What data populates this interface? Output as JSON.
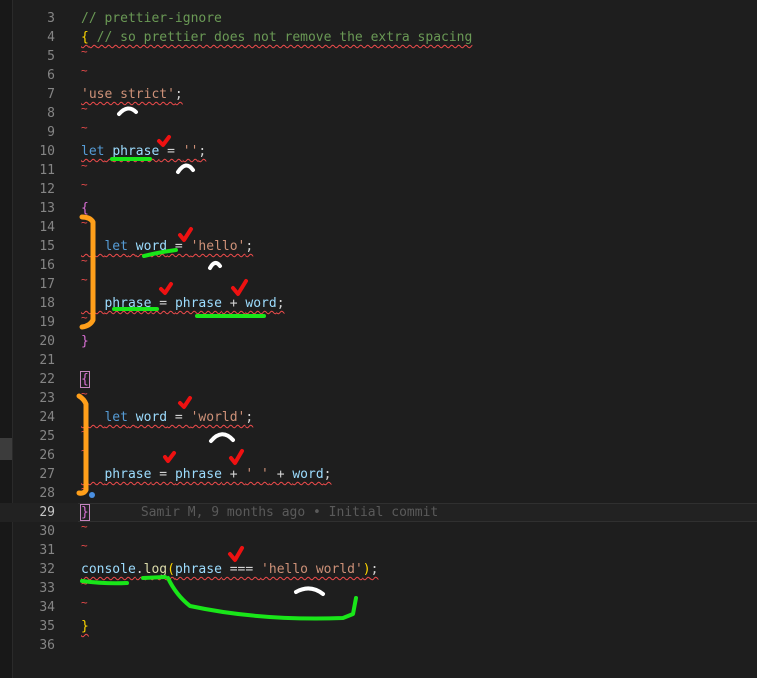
{
  "editor": {
    "lines": [
      {
        "n": "3",
        "parts": [
          [
            "c",
            "// prettier-ignore"
          ]
        ]
      },
      {
        "n": "4",
        "parts": [
          [
            "b1",
            "{"
          ],
          [
            "p",
            " "
          ],
          [
            "c",
            "// so prettier does not remove the extra spacing"
          ]
        ],
        "squig": true
      },
      {
        "n": "5",
        "tilde": true
      },
      {
        "n": "6",
        "tilde": true
      },
      {
        "n": "7",
        "parts": [
          [
            "s",
            "'use strict'"
          ],
          [
            "p",
            ";"
          ]
        ],
        "squig": true
      },
      {
        "n": "8",
        "tilde": true
      },
      {
        "n": "9",
        "tilde": true
      },
      {
        "n": "10",
        "parts": [
          [
            "k",
            "let"
          ],
          [
            "p",
            " "
          ],
          [
            "v",
            "phrase"
          ],
          [
            "p",
            " = "
          ],
          [
            "s",
            "''"
          ],
          [
            "p",
            ";"
          ]
        ],
        "squig": true
      },
      {
        "n": "11",
        "tilde": true
      },
      {
        "n": "12",
        "tilde": true
      },
      {
        "n": "13",
        "parts": [
          [
            "b2",
            "{"
          ]
        ]
      },
      {
        "n": "14",
        "tilde": true,
        "indent": true
      },
      {
        "n": "15",
        "parts": [
          [
            "p",
            "   "
          ],
          [
            "k",
            "let"
          ],
          [
            "p",
            " "
          ],
          [
            "v",
            "word"
          ],
          [
            "p",
            " = "
          ],
          [
            "s",
            "'hello'"
          ],
          [
            "p",
            ";"
          ]
        ],
        "squig": true
      },
      {
        "n": "16",
        "tilde": true,
        "indent": true
      },
      {
        "n": "17",
        "tilde": true,
        "indent": true
      },
      {
        "n": "18",
        "parts": [
          [
            "p",
            "   "
          ],
          [
            "v",
            "phrase"
          ],
          [
            "p",
            " = "
          ],
          [
            "v",
            "phrase"
          ],
          [
            "p",
            " + "
          ],
          [
            "v",
            "word"
          ],
          [
            "p",
            ";"
          ]
        ],
        "squig": true
      },
      {
        "n": "19",
        "tilde": true,
        "indent": true
      },
      {
        "n": "20",
        "parts": [
          [
            "b2",
            "}"
          ]
        ]
      },
      {
        "n": "21"
      },
      {
        "n": "22",
        "parts": [
          [
            "b2box",
            "{"
          ]
        ]
      },
      {
        "n": "23",
        "tilde": true,
        "indent": true
      },
      {
        "n": "24",
        "parts": [
          [
            "p",
            "   "
          ],
          [
            "k",
            "let"
          ],
          [
            "p",
            " "
          ],
          [
            "v",
            "word"
          ],
          [
            "p",
            " = "
          ],
          [
            "s",
            "'world'"
          ],
          [
            "p",
            ";"
          ]
        ],
        "squig": true
      },
      {
        "n": "25",
        "tilde": true,
        "indent": true
      },
      {
        "n": "26",
        "tilde": true,
        "indent": true
      },
      {
        "n": "27",
        "parts": [
          [
            "p",
            "   "
          ],
          [
            "v",
            "phrase"
          ],
          [
            "p",
            " = "
          ],
          [
            "v",
            "phrase"
          ],
          [
            "p",
            " + "
          ],
          [
            "s",
            "' '"
          ],
          [
            "p",
            " + "
          ],
          [
            "v",
            "word"
          ],
          [
            "p",
            ";"
          ]
        ],
        "squig": true
      },
      {
        "n": "28",
        "tilde": true,
        "indent": true
      },
      {
        "n": "29",
        "parts": [
          [
            "b2box",
            "}"
          ]
        ],
        "current": true,
        "blame": "Samir M, 9 months ago • Initial commit"
      },
      {
        "n": "30",
        "tilde": true
      },
      {
        "n": "31",
        "tilde": true
      },
      {
        "n": "32",
        "parts": [
          [
            "v",
            "console"
          ],
          [
            "p",
            "."
          ],
          [
            "f",
            "log"
          ],
          [
            "b1",
            "("
          ],
          [
            "v",
            "phrase"
          ],
          [
            "p",
            " === "
          ],
          [
            "s",
            "'hello world'"
          ],
          [
            "b1",
            ")"
          ],
          [
            "p",
            ";"
          ]
        ],
        "squig": true
      },
      {
        "n": "33",
        "tilde": true
      },
      {
        "n": "34",
        "tilde": true
      },
      {
        "n": "35",
        "parts": [
          [
            "b1",
            "}"
          ]
        ],
        "squig": true
      },
      {
        "n": "36"
      }
    ]
  },
  "colors": {
    "background": "#1e1e1e",
    "squiggle": "#f14c4c",
    "annotation_green": "#19e619",
    "annotation_orange": "#ff9f1a",
    "annotation_red": "#ee1111",
    "annotation_white": "#ffffff"
  }
}
